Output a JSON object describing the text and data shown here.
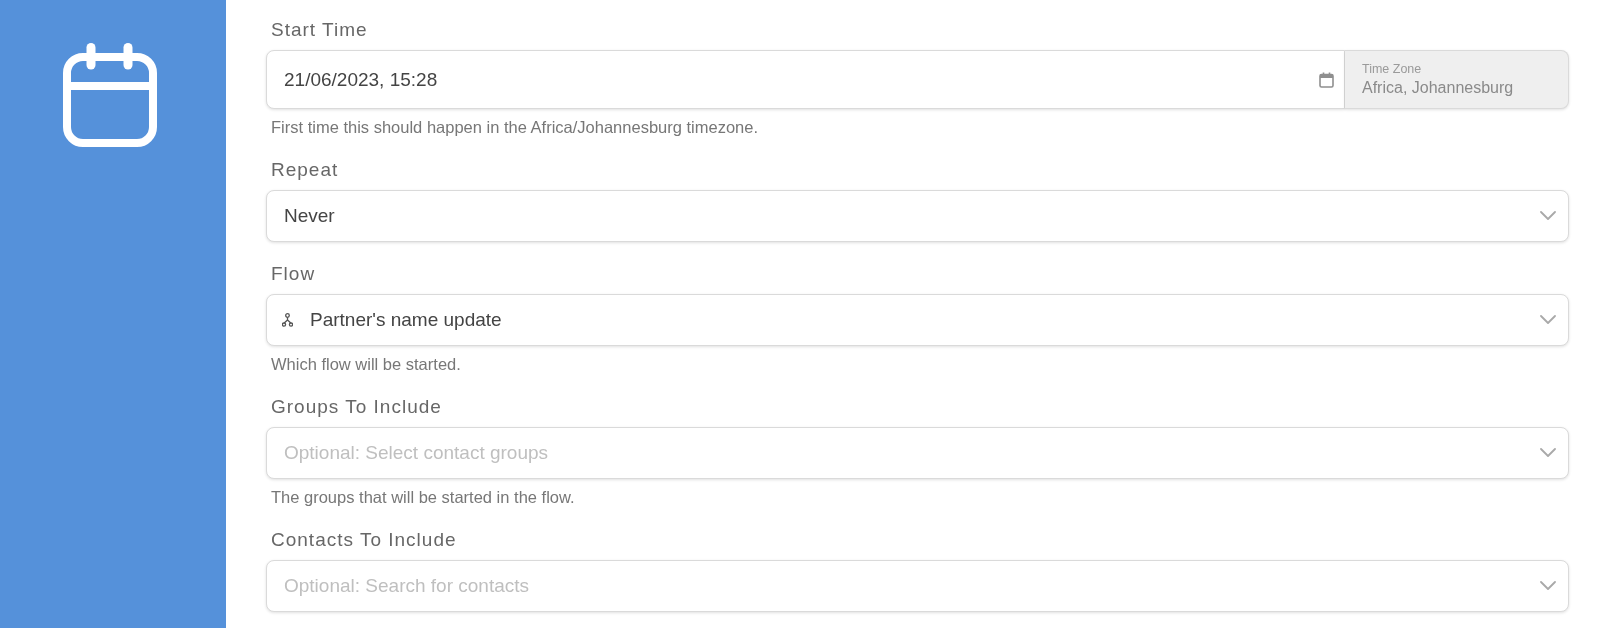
{
  "fields": [
    {
      "kind": "datetime",
      "label": "Start Time",
      "value": "21/06/2023, 15:28",
      "time_zone": {
        "label": "Time Zone",
        "value": "Africa, Johannesburg"
      },
      "help": "First time this should happen in the Africa/Johannesburg timezone."
    },
    {
      "kind": "select",
      "label": "Repeat",
      "value": "Never"
    },
    {
      "kind": "flow",
      "label": "Flow",
      "value": "Partner's name update",
      "help": "Which flow will be started."
    },
    {
      "kind": "select",
      "label": "Groups To Include",
      "placeholder": "Optional: Select contact groups",
      "help": "The groups that will be started in the flow."
    },
    {
      "kind": "select",
      "label": "Contacts To Include",
      "placeholder": "Optional: Search for contacts"
    }
  ]
}
